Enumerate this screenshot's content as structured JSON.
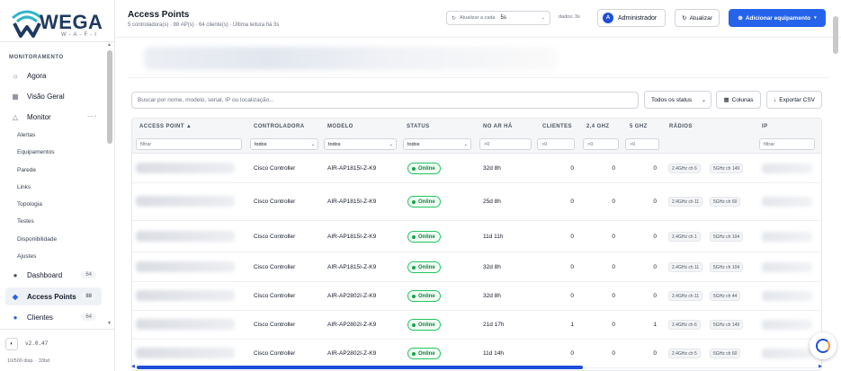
{
  "brand": {
    "name": "WEGA",
    "sub": "W-A-F-I"
  },
  "sidebar": {
    "section": "MONITORAMENTO",
    "items_top": [
      {
        "label": "Agora",
        "icon": "sun-icon"
      },
      {
        "label": "Visão Geral",
        "icon": "grid-icon"
      },
      {
        "label": "Monitor",
        "icon": "alert-triangle-icon"
      }
    ],
    "monitor_sub": [
      "Alertas",
      "Equipamentos",
      "Parede",
      "Links",
      "Topologia",
      "Testes",
      "Disponibilidade",
      "Ajustes"
    ],
    "items_bottom": [
      {
        "label": "Dashboard",
        "badge": "64"
      },
      {
        "label": "Access Points",
        "badge": "88"
      },
      {
        "label": "Clientes",
        "badge": "64"
      }
    ],
    "version": "v2.0.47",
    "footer": "10/500 disp. · 33bd"
  },
  "header": {
    "title": "Access Points",
    "subtitle": "5 controladora(s) · 88 AP(s) · 64 cliente(s) · Última leitura há 3s",
    "refresh_label": "Atualizar a cada",
    "refresh_value": "5s",
    "data_age": "dados: 3s",
    "admin_initial": "A",
    "admin_label": "Administrador",
    "update_label": "Atualizar",
    "add_label": "Adicionar equipamento"
  },
  "toolbar": {
    "search_placeholder": "Buscar por nome, modelo, serial, IP ou localização...",
    "status_filter": "Todos os status",
    "columns_label": "Colunas",
    "csv_label": "Exportar CSV"
  },
  "table": {
    "headers": {
      "ap": "ACCESS POINT ▲",
      "controller": "CONTROLADORA",
      "model": "MODELO",
      "status": "STATUS",
      "uptime": "NO AR HÁ",
      "clients": "CLIENTES",
      "g24": "2,4 GHZ",
      "g5": "5 GHZ",
      "radios": "RÁDIOS",
      "ip": "IP"
    },
    "filters": {
      "ap": "filtrar",
      "controller": "todos",
      "model": "todos",
      "status": "todos",
      "uptime": ">0",
      "clients": ">0",
      "g24": ">0",
      "g5": ">0",
      "ip": "filtrar"
    },
    "rows": [
      {
        "controller": "Cisco Controller",
        "model": "AIR-AP1815I-Z-K9",
        "status": "Online",
        "uptime": "32d 8h",
        "clients": "0",
        "g24": "0",
        "g5": "0",
        "r1": "2.4GHz ch 6",
        "r2": "5GHz ch 149"
      },
      {
        "controller": "Cisco Controller",
        "model": "AIR-AP1815I-Z-K9",
        "status": "Online",
        "uptime": "25d 8h",
        "clients": "0",
        "g24": "0",
        "g5": "0",
        "r1": "2.4GHz ch 11",
        "r2": "5GHz ch 60"
      },
      {
        "controller": "Cisco Controller",
        "model": "AIR-AP1815I-Z-K9",
        "status": "Online",
        "uptime": "11d 11h",
        "clients": "0",
        "g24": "0",
        "g5": "0",
        "r1": "2.4GHz ch 1",
        "r2": "5GHz ch 104"
      },
      {
        "controller": "Cisco Controller",
        "model": "AIR-AP1815I-Z-K9",
        "status": "Online",
        "uptime": "32d 8h",
        "clients": "0",
        "g24": "0",
        "g5": "0",
        "r1": "2.4GHz ch 11",
        "r2": "5GHz ch 104"
      },
      {
        "controller": "Cisco Controller",
        "model": "AIR-AP2802I-Z-K9",
        "status": "Online",
        "uptime": "32d 8h",
        "clients": "0",
        "g24": "0",
        "g5": "0",
        "r1": "2.4GHz ch 11",
        "r2": "5GHz ch 44"
      },
      {
        "controller": "Cisco Controller",
        "model": "AIR-AP2802I-Z-K9",
        "status": "Online",
        "uptime": "21d 17h",
        "clients": "1",
        "g24": "0",
        "g5": "1",
        "r1": "2.4GHz ch 6",
        "r2": "5GHz ch 149"
      },
      {
        "controller": "Cisco Controller",
        "model": "AIR-AP2802I-Z-K9",
        "status": "Online",
        "uptime": "11d 14h",
        "clients": "0",
        "g24": "0",
        "g5": "0",
        "r1": "2.4GHz ch 5",
        "r2": "5GHz ch 60"
      }
    ]
  },
  "colors": {
    "accent": "#2563eb",
    "online": "#16a34a",
    "brand": "#1e3a5f"
  }
}
